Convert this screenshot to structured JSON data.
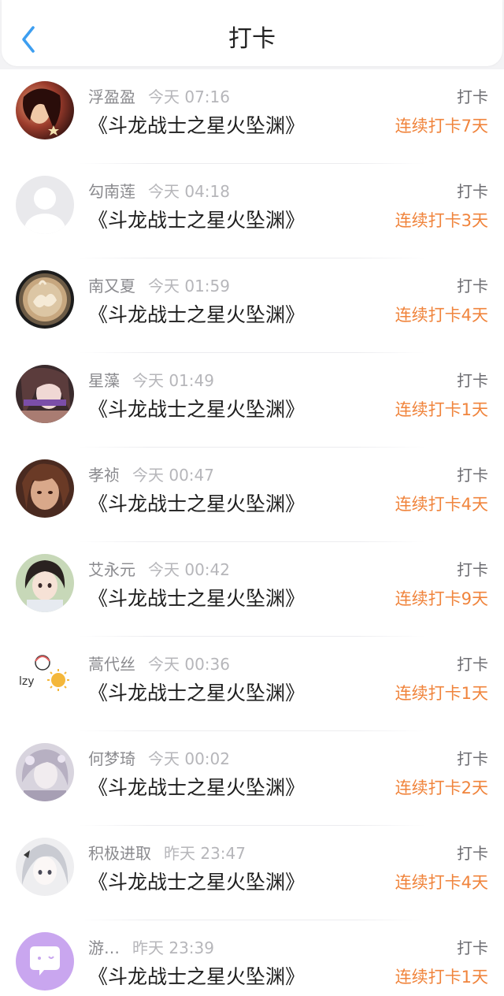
{
  "header": {
    "title": "打卡"
  },
  "entries": [
    {
      "name": "浮盈盈",
      "time": "今天 07:16",
      "book": "《斗龙战士之星火坠渊》",
      "action": "打卡",
      "streak": "连续打卡7天"
    },
    {
      "name": "勾南莲",
      "time": "今天 04:18",
      "book": "《斗龙战士之星火坠渊》",
      "action": "打卡",
      "streak": "连续打卡3天"
    },
    {
      "name": "南又夏",
      "time": "今天 01:59",
      "book": "《斗龙战士之星火坠渊》",
      "action": "打卡",
      "streak": "连续打卡4天"
    },
    {
      "name": "星藻",
      "time": "今天 01:49",
      "book": "《斗龙战士之星火坠渊》",
      "action": "打卡",
      "streak": "连续打卡1天"
    },
    {
      "name": "孝祯",
      "time": "今天 00:47",
      "book": "《斗龙战士之星火坠渊》",
      "action": "打卡",
      "streak": "连续打卡4天"
    },
    {
      "name": "艾永元",
      "time": "今天 00:42",
      "book": "《斗龙战士之星火坠渊》",
      "action": "打卡",
      "streak": "连续打卡9天"
    },
    {
      "name": "蒿代丝",
      "time": "今天 00:36",
      "book": "《斗龙战士之星火坠渊》",
      "action": "打卡",
      "streak": "连续打卡1天"
    },
    {
      "name": "何梦琦",
      "time": "今天 00:02",
      "book": "《斗龙战士之星火坠渊》",
      "action": "打卡",
      "streak": "连续打卡2天"
    },
    {
      "name": "积极进取",
      "time": "昨天 23:47",
      "book": "《斗龙战士之星火坠渊》",
      "action": "打卡",
      "streak": "连续打卡4天"
    },
    {
      "name": "游…",
      "time": "昨天 23:39",
      "book": "《斗龙战士之星火坠渊》",
      "action": "打卡",
      "streak": "连续打卡1天"
    }
  ],
  "colors": {
    "accent": "#f0843c",
    "back_arrow": "#3d9ef0"
  }
}
